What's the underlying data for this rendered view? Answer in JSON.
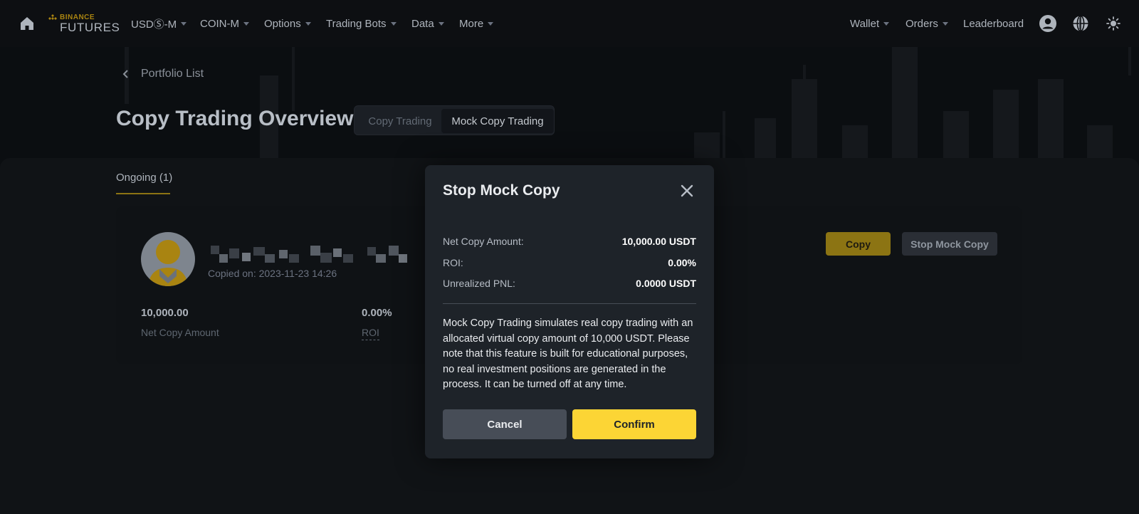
{
  "nav": {
    "logo_top": "BINANCE",
    "logo_bottom": "FUTURES",
    "items": [
      {
        "label": "USDⓈ-M",
        "has_caret": true
      },
      {
        "label": "COIN-M",
        "has_caret": true
      },
      {
        "label": "Options",
        "has_caret": true
      },
      {
        "label": "Trading Bots",
        "has_caret": true
      },
      {
        "label": "Data",
        "has_caret": true
      },
      {
        "label": "More",
        "has_caret": true
      }
    ],
    "right_items": [
      {
        "label": "Wallet",
        "has_caret": true
      },
      {
        "label": "Orders",
        "has_caret": true
      },
      {
        "label": "Leaderboard",
        "has_caret": false
      }
    ],
    "icons": [
      "home-icon",
      "user-icon",
      "globe-icon",
      "theme-icon"
    ]
  },
  "header": {
    "back_label": "Portfolio List",
    "title": "Copy Trading Overview",
    "segment": {
      "options": [
        "Copy Trading",
        "Mock Copy Trading"
      ],
      "selected": "Mock Copy Trading"
    }
  },
  "tabs": [
    {
      "label": "Ongoing (1)",
      "active": true
    }
  ],
  "card": {
    "copied_on": "Copied on: 2023-11-23 14:26",
    "stats": [
      {
        "value": "10,000.00",
        "label": "Net Copy Amount"
      },
      {
        "value": "0.00%",
        "label": "ROI"
      }
    ],
    "copy_button": "Copy",
    "stop_button": "Stop Mock Copy"
  },
  "modal": {
    "title": "Stop Mock Copy",
    "rows": [
      {
        "key": "Net Copy Amount:",
        "value": "10,000.00 USDT"
      },
      {
        "key": "ROI:",
        "value": "0.00%"
      },
      {
        "key": "Unrealized PNL:",
        "value": "0.0000 USDT"
      }
    ],
    "description": "Mock Copy Trading simulates real copy trading with an allocated virtual copy amount of 10,000 USDT. Please note that this feature is built for educational purposes, no real investment positions are generated in the process. It can be turned off at any time.",
    "cancel_label": "Cancel",
    "confirm_label": "Confirm"
  },
  "colors": {
    "accent": "#fcd535",
    "background": "#0b0e11",
    "modal_bg": "#1e2329"
  }
}
